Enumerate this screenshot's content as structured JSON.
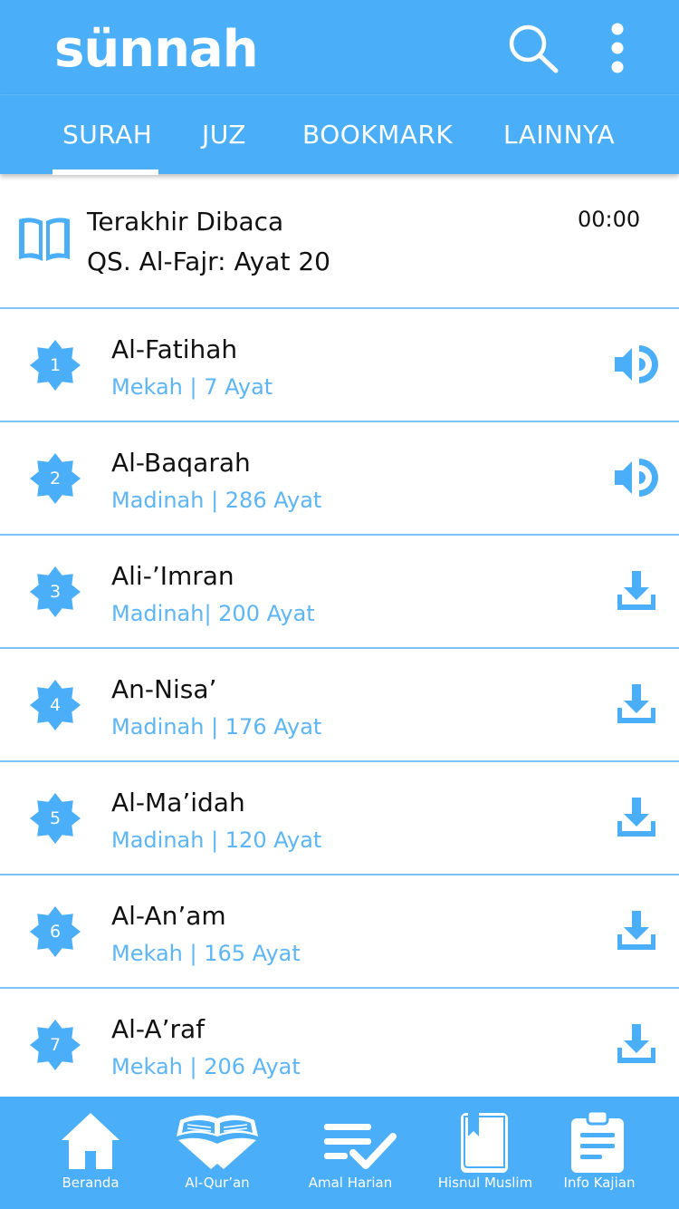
{
  "app": {
    "logo": "sünnah"
  },
  "tabs": [
    {
      "label": "SURAH",
      "active": true
    },
    {
      "label": "JUZ",
      "active": false
    },
    {
      "label": "BOOKMARK",
      "active": false
    },
    {
      "label": "LAINNYA",
      "active": false
    }
  ],
  "last_read": {
    "title": "Terakhir Dibaca",
    "surah": "QS. Al-Fajr: Ayat 20",
    "time": "00:00",
    "icon": "book-open-icon"
  },
  "surahs": [
    {
      "number": "1",
      "name": "Al-Fatihah",
      "info": "Mekah | 7 Ayat",
      "action": "audio-icon"
    },
    {
      "number": "2",
      "name": "Al-Baqarah",
      "info": "Madinah | 286 Ayat",
      "action": "audio-icon"
    },
    {
      "number": "3",
      "name": "Ali-’Imran",
      "info": "Madinah| 200 Ayat",
      "action": "download-icon"
    },
    {
      "number": "4",
      "name": "An-Nisa’",
      "info": "Madinah | 176 Ayat",
      "action": "download-icon"
    },
    {
      "number": "5",
      "name": "Al-Ma’idah",
      "info": "Madinah | 120 Ayat",
      "action": "download-icon"
    },
    {
      "number": "6",
      "name": "Al-An’am",
      "info": "Mekah | 165 Ayat",
      "action": "download-icon"
    },
    {
      "number": "7",
      "name": "Al-A’raf",
      "info": "Mekah | 206 Ayat",
      "action": "download-icon"
    }
  ],
  "bottom_nav": [
    {
      "label": "Beranda",
      "icon": "home-icon"
    },
    {
      "label": "Al-Qur’an",
      "icon": "quran-icon"
    },
    {
      "label": "Amal Harian",
      "icon": "checklist-icon"
    },
    {
      "label": "Hisnul Muslim",
      "icon": "book-icon"
    },
    {
      "label": "Info Kajian",
      "icon": "clipboard-icon"
    }
  ],
  "colors": {
    "primary": "#4AAEF8",
    "accent_text": "#5DB5F5",
    "divider": "#7CC4F7"
  }
}
